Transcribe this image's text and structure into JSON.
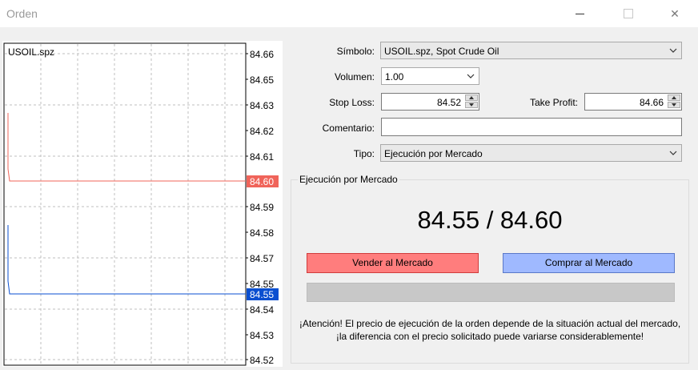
{
  "window": {
    "title": "Orden",
    "minimize": "—",
    "close": "✕"
  },
  "chart": {
    "symbol": "USOIL.spz",
    "price_labels": [
      "84.66",
      "84.65",
      "84.63",
      "84.62",
      "84.61",
      "84.59",
      "84.58",
      "84.57",
      "84.55",
      "84.54",
      "84.53",
      "84.52"
    ],
    "ask_label": "84.60",
    "bid_label": "84.55",
    "colors": {
      "ask": "#f0645a",
      "bid": "#0a4fd0",
      "grid": "#bfbfbf"
    }
  },
  "form": {
    "symbol_label": "Símbolo:",
    "symbol_value": "USOIL.spz, Spot Crude Oil",
    "volume_label": "Volumen:",
    "volume_value": "1.00",
    "stoploss_label": "Stop Loss:",
    "stoploss_value": "84.52",
    "takeprofit_label": "Take Profit:",
    "takeprofit_value": "84.66",
    "comment_label": "Comentario:",
    "comment_value": "",
    "type_label": "Tipo:",
    "type_value": "Ejecución por Mercado"
  },
  "execution": {
    "group_title": "Ejecución por Mercado",
    "price": "84.55 / 84.60",
    "sell_label": "Vender al Mercado",
    "buy_label": "Comprar al Mercado",
    "warning": "¡Atención! El precio de ejecución de la orden depende de la situación actual del mercado, ¡la diferencia con el precio solicitado puede variarse considerablemente!"
  }
}
